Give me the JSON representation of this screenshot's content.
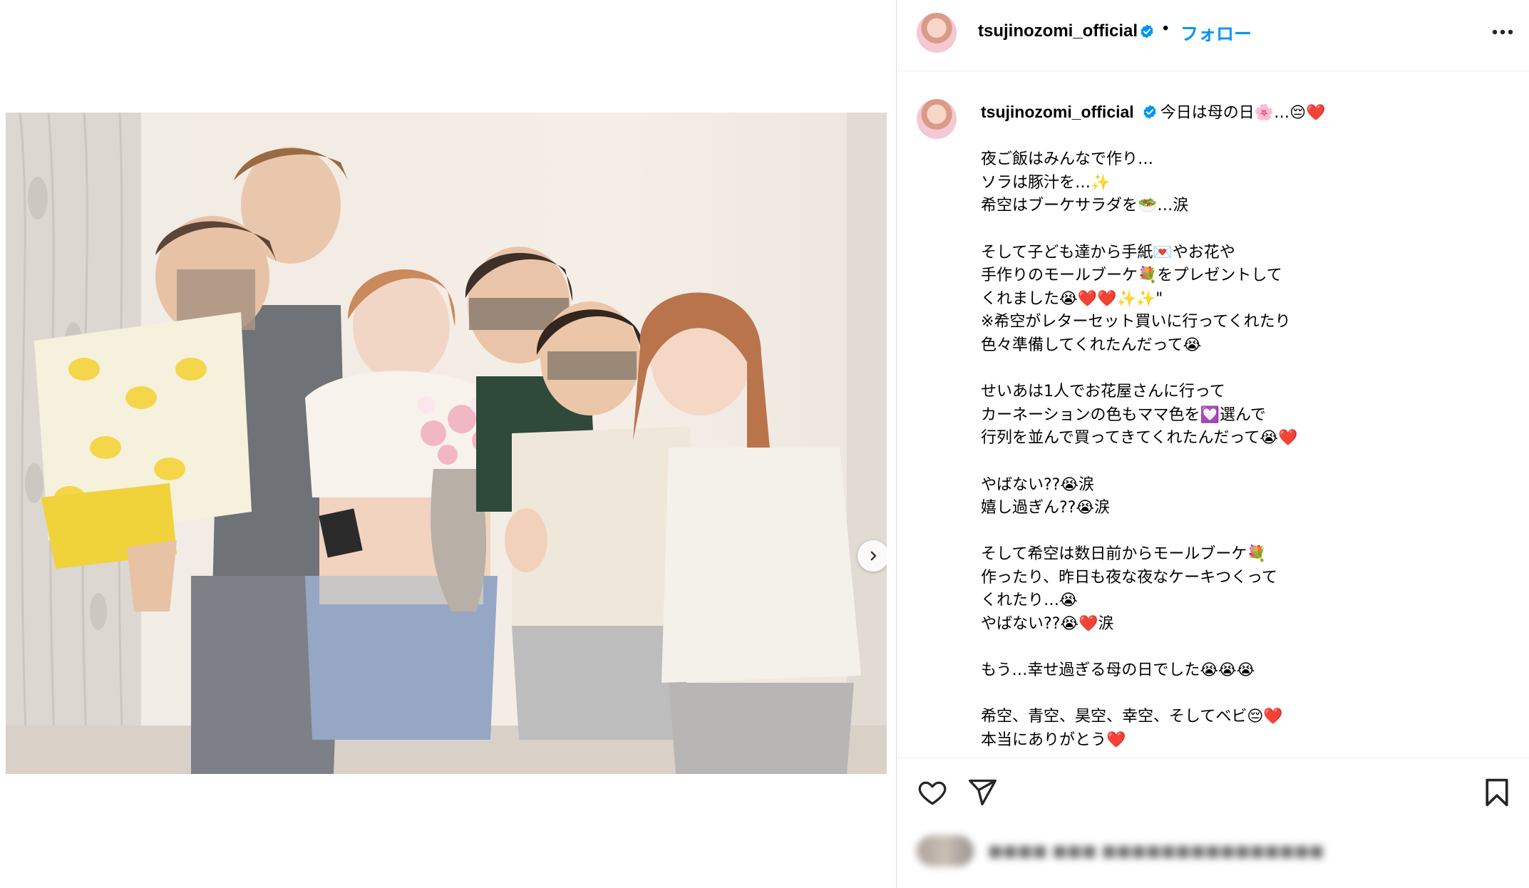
{
  "post": {
    "username": "tsujinozomi_official",
    "separator": "•",
    "follow_label": "フォロー",
    "more_icon": "more-horizontal-icon"
  },
  "media": {
    "next_icon": "chevron-right-icon"
  },
  "caption": {
    "username": "tsujinozomi_official",
    "first_line": "今日は母の日🌸…😔❤️",
    "lines": [
      "",
      "夜ご飯はみんなで作り…",
      "ソラは豚汁を…✨",
      "希空はブーケサラダを🥗…涙",
      "",
      "そして子ども達から手紙💌やお花や",
      "手作りのモールブーケ💐をプレゼントして",
      "くれました😭❤️❤️✨✨\"",
      "※希空がレターセット買いに行ってくれたり",
      "色々準備してくれたんだって😭",
      "",
      "せいあは1人でお花屋さんに行って",
      "カーネーションの色もママ色を💟選んで",
      "行列を並んで買ってきてくれたんだって😭❤️",
      "",
      "やばない??😭涙",
      "嬉し過ぎん??😭涙",
      "",
      "そして希空は数日前からモールブーケ💐",
      "作ったり、昨日も夜な夜なケーキつくって",
      "くれたり…😭",
      "やばない??😭❤️涙",
      "",
      "もう…幸せ過ぎる母の日でした😭😭😭",
      "",
      "希空、青空、昊空、幸空、そしてベビ😔❤️",
      "本当にありがとう❤️"
    ]
  },
  "actions": {
    "like_icon": "heart-icon",
    "share_icon": "send-icon",
    "save_icon": "bookmark-icon"
  },
  "colors": {
    "accent": "#0095f6",
    "verified": "#0095f6",
    "border": "#dbdbdb"
  }
}
